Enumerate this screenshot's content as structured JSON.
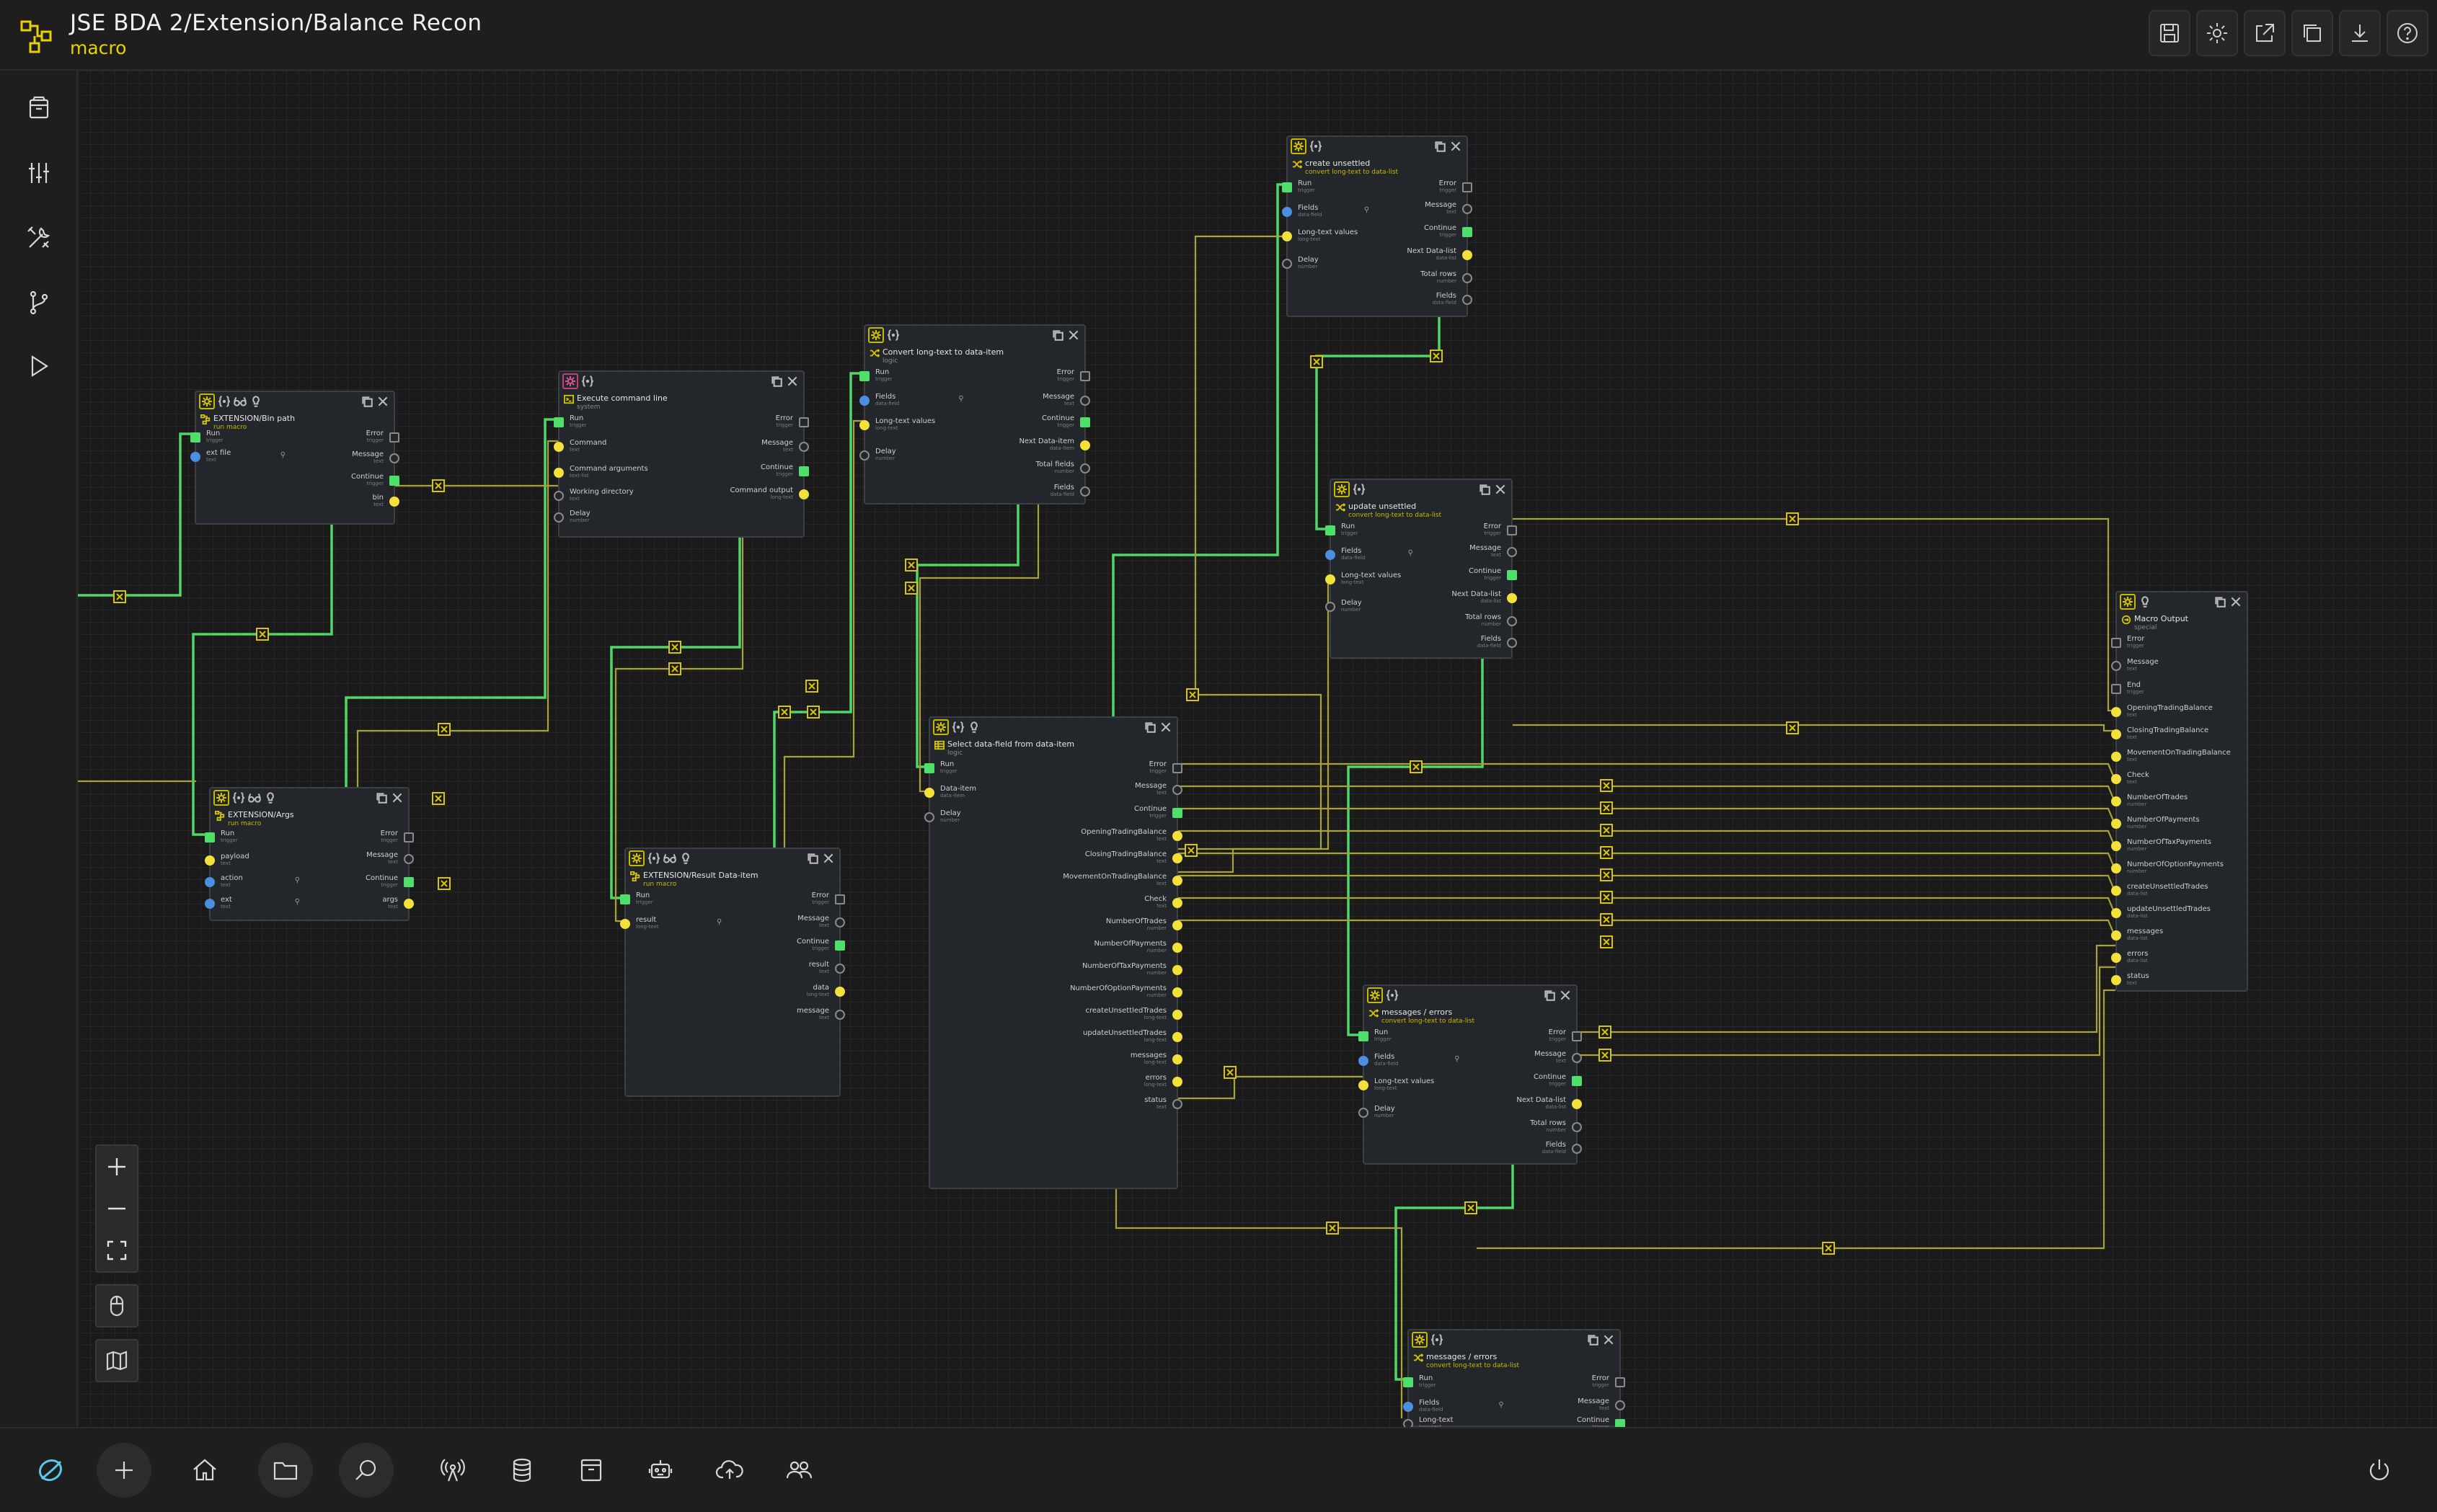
{
  "header": {
    "title": "JSE BDA 2/Extension/Balance Recon",
    "subtitle": "macro"
  },
  "icons": {
    "header": [
      "save-icon",
      "settings-icon",
      "export-icon",
      "copy-icon",
      "download-icon",
      "help-icon"
    ],
    "rail": [
      "library-icon",
      "sliders-icon",
      "tools-icon",
      "branch-icon",
      "run-icon"
    ],
    "bottom": [
      "app-logo-icon",
      "add-icon",
      "home-icon",
      "folder-icon",
      "search-icon",
      "broadcast-icon",
      "database-icon",
      "package-icon",
      "robot-icon",
      "cloud-upload-icon",
      "users-icon",
      "power-icon"
    ]
  },
  "colors": {
    "accent_yellow": "#e8d100",
    "port_green": "#4ee06b",
    "port_yellow": "#f2e13a",
    "port_blue": "#4a8fe0",
    "wire_green": "#52d66a",
    "wire_olive": "#a9a23a"
  },
  "nodes": {
    "bin_path": {
      "title": "EXTENSION/Bin path",
      "sub": "run macro",
      "in": [
        [
          "Run",
          "trigger"
        ],
        [
          "ext file",
          "text"
        ]
      ],
      "out": [
        [
          "Error",
          "trigger"
        ],
        [
          "Message",
          "text"
        ],
        [
          "Continue",
          "trigger"
        ],
        [
          "bin",
          "text"
        ]
      ]
    },
    "args": {
      "title": "EXTENSION/Args",
      "sub": "run macro",
      "in": [
        [
          "Run",
          "trigger"
        ],
        [
          "payload",
          "text"
        ],
        [
          "action",
          "text"
        ],
        [
          "ext",
          "text"
        ]
      ],
      "out": [
        [
          "Error",
          "trigger"
        ],
        [
          "Message",
          "text"
        ],
        [
          "Continue",
          "trigger"
        ],
        [
          "args",
          "text"
        ]
      ]
    },
    "exec": {
      "title": "Execute command line",
      "sub": "system",
      "in": [
        [
          "Run",
          "trigger"
        ],
        [
          "Command",
          "text"
        ],
        [
          "Command arguments",
          "text-list"
        ],
        [
          "Working directory",
          "text"
        ],
        [
          "Delay",
          "number"
        ]
      ],
      "out": [
        [
          "Error",
          "trigger"
        ],
        [
          "Message",
          "text"
        ],
        [
          "Continue",
          "trigger"
        ],
        [
          "Command output",
          "long-text"
        ]
      ]
    },
    "result": {
      "title": "EXTENSION/Result Data-item",
      "sub": "run macro",
      "in": [
        [
          "Run",
          "trigger"
        ],
        [
          "result",
          "long-text"
        ]
      ],
      "out": [
        [
          "Error",
          "trigger"
        ],
        [
          "Message",
          "text"
        ],
        [
          "Continue",
          "trigger"
        ],
        [
          "result",
          "text"
        ],
        [
          "data",
          "long-text"
        ],
        [
          "message",
          "text"
        ]
      ]
    },
    "convert_item": {
      "title": "Convert long-text to data-item",
      "sub": "logic",
      "in": [
        [
          "Run",
          "trigger"
        ],
        [
          "Fields",
          "data-field"
        ],
        [
          "Long-text values",
          "long-text"
        ],
        [
          "Delay",
          "number"
        ]
      ],
      "out": [
        [
          "Error",
          "trigger"
        ],
        [
          "Message",
          "text"
        ],
        [
          "Continue",
          "trigger"
        ],
        [
          "Next Data-item",
          "data-item"
        ],
        [
          "Total fields",
          "number"
        ],
        [
          "Fields",
          "data-field"
        ]
      ]
    },
    "select_field": {
      "title": "Select data-field from data-item",
      "sub": "logic",
      "in": [
        [
          "Run",
          "trigger"
        ],
        [
          "Data-item",
          "data-item"
        ],
        [
          "Delay",
          "number"
        ]
      ],
      "out": [
        [
          "Error",
          "trigger"
        ],
        [
          "Message",
          "text"
        ],
        [
          "Continue",
          "trigger"
        ],
        [
          "OpeningTradingBalance",
          "text"
        ],
        [
          "ClosingTradingBalance",
          "text"
        ],
        [
          "MovementOnTradingBalance",
          "text"
        ],
        [
          "Check",
          "text"
        ],
        [
          "NumberOfTrades",
          "number"
        ],
        [
          "NumberOfPayments",
          "number"
        ],
        [
          "NumberOfTaxPayments",
          "number"
        ],
        [
          "NumberOfOptionPayments",
          "number"
        ],
        [
          "createUnsettledTrades",
          "long-text"
        ],
        [
          "updateUnsettledTrades",
          "long-text"
        ],
        [
          "messages",
          "long-text"
        ],
        [
          "errors",
          "long-text"
        ],
        [
          "status",
          "text"
        ]
      ]
    },
    "create_unsettled": {
      "title": "create unsettled",
      "sub": "convert long-text to data-list",
      "in": [
        [
          "Run",
          "trigger"
        ],
        [
          "Fields",
          "data-field"
        ],
        [
          "Long-text values",
          "long-text"
        ],
        [
          "Delay",
          "number"
        ]
      ],
      "out": [
        [
          "Error",
          "trigger"
        ],
        [
          "Message",
          "text"
        ],
        [
          "Continue",
          "trigger"
        ],
        [
          "Next Data-list",
          "data-list"
        ],
        [
          "Total rows",
          "number"
        ],
        [
          "Fields",
          "data-field"
        ]
      ]
    },
    "update_unsettled": {
      "title": "update unsettled",
      "sub": "convert long-text to data-list",
      "in": [
        [
          "Run",
          "trigger"
        ],
        [
          "Fields",
          "data-field"
        ],
        [
          "Long-text values",
          "long-text"
        ],
        [
          "Delay",
          "number"
        ]
      ],
      "out": [
        [
          "Error",
          "trigger"
        ],
        [
          "Message",
          "text"
        ],
        [
          "Continue",
          "trigger"
        ],
        [
          "Next Data-list",
          "data-list"
        ],
        [
          "Total rows",
          "number"
        ],
        [
          "Fields",
          "data-field"
        ]
      ]
    },
    "messages_errors": {
      "title": "messages / errors",
      "sub": "convert long-text to data-list",
      "in": [
        [
          "Run",
          "trigger"
        ],
        [
          "Fields",
          "data-field"
        ],
        [
          "Long-text values",
          "long-text"
        ],
        [
          "Delay",
          "number"
        ]
      ],
      "out": [
        [
          "Error",
          "trigger"
        ],
        [
          "Message",
          "text"
        ],
        [
          "Continue",
          "trigger"
        ],
        [
          "Next Data-list",
          "data-list"
        ],
        [
          "Total rows",
          "number"
        ],
        [
          "Fields",
          "data-field"
        ]
      ]
    },
    "messages_errors_2": {
      "title": "messages / errors",
      "sub": "convert long-text to data-list",
      "in": [
        [
          "Run",
          "trigger"
        ],
        [
          "Fields",
          "data-field"
        ],
        [
          "Long-text",
          "long-text"
        ]
      ],
      "out": [
        [
          "Error",
          "trigger"
        ],
        [
          "Message",
          "text"
        ],
        [
          "Continue",
          "trigger"
        ]
      ]
    },
    "macro_output": {
      "title": "Macro Output",
      "sub": "special",
      "in": [
        [
          "Error",
          "trigger"
        ],
        [
          "Message",
          "text"
        ],
        [
          "End",
          "trigger"
        ],
        [
          "OpeningTradingBalance",
          "text"
        ],
        [
          "ClosingTradingBalance",
          "text"
        ],
        [
          "MovementOnTradingBalance",
          "text"
        ],
        [
          "Check",
          "text"
        ],
        [
          "NumberOfTrades",
          "number"
        ],
        [
          "NumberOfPayments",
          "number"
        ],
        [
          "NumberOfTaxPayments",
          "number"
        ],
        [
          "NumberOfOptionPayments",
          "number"
        ],
        [
          "createUnsettledTrades",
          "data-list"
        ],
        [
          "updateUnsettledTrades",
          "data-list"
        ],
        [
          "messages",
          "data-list"
        ],
        [
          "errors",
          "data-list"
        ],
        [
          "status",
          "text"
        ]
      ]
    }
  }
}
